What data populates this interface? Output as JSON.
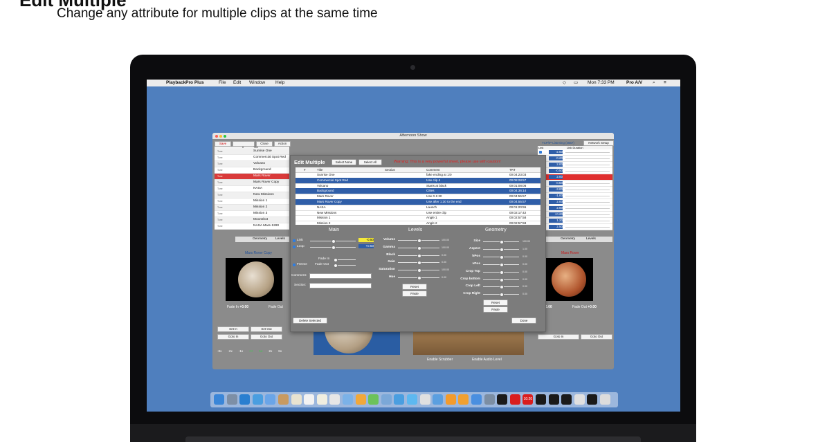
{
  "page": {
    "title": "Edit Multiple",
    "subtitle": "Change any attribute for multiple clips at the same time"
  },
  "menubar": {
    "app": "PlaybackPro Plus",
    "items": [
      "File",
      "Edit",
      "Window",
      "Help"
    ],
    "clock": "Mon 7:33 PM",
    "user": "Pro A/V"
  },
  "window": {
    "title": "Afternoon Show",
    "toolbar": [
      "Save",
      "Close",
      "Action"
    ],
    "right_tabs": [
      "TCP/IP Listening (4567)",
      "Network Setup"
    ],
    "col_hash": "#",
    "col_title": "Title",
    "col_link": "Link",
    "col_link_duration": "Link Duration",
    "left_preview_label": "Mars Rover Copy",
    "right_preview_label": "Mars Rover",
    "tab_geometry": "Geometry",
    "tab_levels": "Levels",
    "fade_in_label": "Fade In",
    "fade_in_value": "+0.00",
    "fade_out_label": "Fade Out",
    "fade_out_value": "+0.00",
    "goto_in": "Goto In",
    "goto_out": "Goto Out",
    "set_in": "Set In",
    "set_out": "Set Out",
    "enable_scrubber": "Enable Scrubber",
    "enable_audio": "Enable Audio Level",
    "speeds": [
      "-8x",
      "-2x",
      "-1x",
      "<<",
      "1x",
      "2x",
      "8x"
    ]
  },
  "clips": [
    {
      "type": "Tone",
      "title": "Sunrise One",
      "state": "alt"
    },
    {
      "type": "Tone",
      "title": "Commercial Spot Red",
      "state": ""
    },
    {
      "type": "Tone",
      "title": "Volcano",
      "state": "alt"
    },
    {
      "type": "Tone",
      "title": "Background",
      "state": ""
    },
    {
      "type": "Tone",
      "title": "Mars Rover",
      "state": "sel"
    },
    {
      "type": "Tone",
      "title": "Mars Rover Copy",
      "state": "alt"
    },
    {
      "type": "Tone",
      "title": "NASA",
      "state": ""
    },
    {
      "type": "Tone",
      "title": "New Missions",
      "state": "alt"
    },
    {
      "type": "Tone",
      "title": "Mission 1",
      "state": ""
    },
    {
      "type": "Tone",
      "title": "Mission 2",
      "state": "alt"
    },
    {
      "type": "Tone",
      "title": "Mission 3",
      "state": ""
    },
    {
      "type": "Tone",
      "title": "Moonshot",
      "state": "alt"
    },
    {
      "type": "Tone",
      "title": "NASA Mars-1280",
      "state": ""
    }
  ],
  "link_values": [
    "-2.50",
    "-0.20",
    "2.00",
    "-0.50",
    "2.00",
    "-0.50",
    "-3.00",
    "-1.00",
    "2.00",
    "2.50",
    "+0.20",
    "1.20",
    "2.50"
  ],
  "dialog": {
    "title": "Edit Multiple",
    "select_none": "Select None",
    "select_all": "Select All",
    "warning": "Warning: This is a very powerful sheet, please use with caution!",
    "columns": [
      "#",
      "Title",
      "Section",
      "Comment",
      "TRT"
    ],
    "rows": [
      {
        "title": "Sunrise One",
        "comment": "fake ending at :20",
        "trt": "00:04:23:03",
        "sel": false
      },
      {
        "title": "Commercial Spot Red",
        "comment": "Use clip 4",
        "trt": "00:08:28:57",
        "sel": true
      },
      {
        "title": "Volcano",
        "comment": "Starts at black",
        "trt": "00:01:08:06",
        "sel": false
      },
      {
        "title": "Background",
        "comment": "Cities",
        "trt": "00:04:36:14",
        "sel": true
      },
      {
        "title": "Mars Rover",
        "comment": "Use 0-1:30",
        "trt": "00:04:55:57",
        "sel": false
      },
      {
        "title": "Mars Rover Copy",
        "comment": "Use after 1:30 to the end",
        "trt": "00:04:55:57",
        "sel": true
      },
      {
        "title": "NASA",
        "comment": "Launch",
        "trt": "00:01:20:55",
        "sel": false
      },
      {
        "title": "New Missions",
        "comment": "Use entire clip",
        "trt": "00:02:17:42",
        "sel": false
      },
      {
        "title": "Mission 1",
        "comment": "Angle 1",
        "trt": "00:02:57:58",
        "sel": false
      },
      {
        "title": "Mission 2",
        "comment": "Angle 2",
        "trt": "00:02:57:58",
        "sel": false
      }
    ],
    "main": {
      "heading": "Main",
      "link_label": "Link",
      "link_value": "-0.50",
      "loop_label": "Loop",
      "loop_value": "+0.50",
      "fade_in": "Fade In",
      "freeze": "Freeze",
      "fade_out": "Fade Out",
      "comment_label": "Comment:",
      "section_label": "Section:"
    },
    "levels": {
      "heading": "Levels",
      "items": [
        {
          "label": "Volume",
          "value": "100.00",
          "level": 0.5
        },
        {
          "label": "Gamma",
          "value": "100.00",
          "level": 0.5
        },
        {
          "label": "Black",
          "value": "0.00",
          "level": 0.5
        },
        {
          "label": "Gain",
          "value": "0.00",
          "level": 0.5
        },
        {
          "label": "Saturation",
          "value": "100.00",
          "level": 0.5
        },
        {
          "label": "Hue",
          "value": "0.00",
          "level": 0.5
        }
      ],
      "reset": "Reset",
      "paste": "Paste"
    },
    "geometry": {
      "heading": "Geometry",
      "items": [
        {
          "label": "Size",
          "value": "100.00",
          "level": 0.5
        },
        {
          "label": "Aspect",
          "value": "1.00",
          "level": 0.5
        },
        {
          "label": "hPos",
          "value": "0.00",
          "level": 0.5
        },
        {
          "label": "vPos",
          "value": "0.00",
          "level": 0.5
        },
        {
          "label": "Crop Top",
          "value": "0.00",
          "level": 0.5
        },
        {
          "label": "Crop bottom",
          "value": "0.00",
          "level": 0.5
        },
        {
          "label": "Crop Left",
          "value": "0.00",
          "level": 0.5
        },
        {
          "label": "Crop Right",
          "value": "0.00",
          "level": 0.5
        }
      ],
      "reset": "Reset",
      "paste": "Paste"
    },
    "delete_selected": "Delete Selected",
    "done": "Done"
  },
  "dock": {
    "clock_text": "10:20"
  }
}
